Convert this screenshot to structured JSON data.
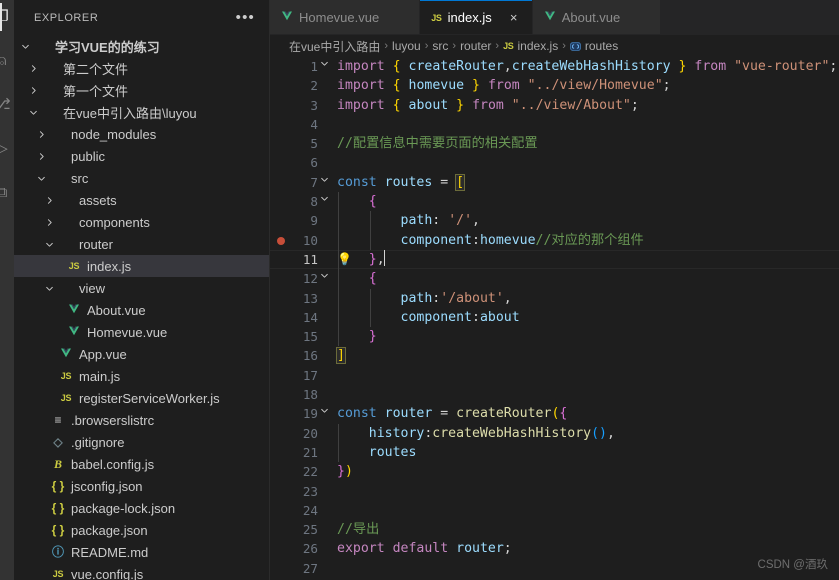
{
  "activity_bar": {
    "items": [
      {
        "name": "explorer",
        "glyph": "❐",
        "active": true
      },
      {
        "name": "search",
        "glyph": "⌕",
        "active": false
      },
      {
        "name": "source-control",
        "glyph": "⎇",
        "active": false
      },
      {
        "name": "run-and-debug",
        "glyph": "▷",
        "active": false
      },
      {
        "name": "extensions",
        "glyph": "⧉",
        "active": false
      }
    ]
  },
  "sidebar": {
    "header": {
      "title": "EXPLORER",
      "actions_label": "•••"
    },
    "tree": [
      {
        "label": "学习VUE的的练习",
        "indent": 0,
        "twisty": "down",
        "icon": "",
        "root": true,
        "selected": false
      },
      {
        "label": "第二个文件",
        "indent": 1,
        "twisty": "right",
        "icon": "",
        "root": false,
        "selected": false
      },
      {
        "label": "第一个文件",
        "indent": 1,
        "twisty": "right",
        "icon": "",
        "root": false,
        "selected": false
      },
      {
        "label": "在vue中引入路由\\luyou",
        "indent": 1,
        "twisty": "down",
        "icon": "",
        "root": false,
        "selected": false
      },
      {
        "label": "node_modules",
        "indent": 2,
        "twisty": "right",
        "icon": "",
        "root": false,
        "selected": false
      },
      {
        "label": "public",
        "indent": 2,
        "twisty": "right",
        "icon": "",
        "root": false,
        "selected": false
      },
      {
        "label": "src",
        "indent": 2,
        "twisty": "down",
        "icon": "",
        "root": false,
        "selected": false
      },
      {
        "label": "assets",
        "indent": 3,
        "twisty": "right",
        "icon": "",
        "root": false,
        "selected": false
      },
      {
        "label": "components",
        "indent": 3,
        "twisty": "right",
        "icon": "",
        "root": false,
        "selected": false
      },
      {
        "label": "router",
        "indent": 3,
        "twisty": "down",
        "icon": "",
        "root": false,
        "selected": false
      },
      {
        "label": "index.js",
        "indent": 4,
        "twisty": "",
        "icon": "js",
        "root": false,
        "selected": true
      },
      {
        "label": "view",
        "indent": 3,
        "twisty": "down",
        "icon": "",
        "root": false,
        "selected": false
      },
      {
        "label": "About.vue",
        "indent": 4,
        "twisty": "",
        "icon": "vue",
        "root": false,
        "selected": false
      },
      {
        "label": "Homevue.vue",
        "indent": 4,
        "twisty": "",
        "icon": "vue",
        "root": false,
        "selected": false
      },
      {
        "label": "App.vue",
        "indent": 3,
        "twisty": "",
        "icon": "vue",
        "root": false,
        "selected": false
      },
      {
        "label": "main.js",
        "indent": 3,
        "twisty": "",
        "icon": "js",
        "root": false,
        "selected": false
      },
      {
        "label": "registerServiceWorker.js",
        "indent": 3,
        "twisty": "",
        "icon": "js",
        "root": false,
        "selected": false
      },
      {
        "label": ".browserslistrc",
        "indent": 2,
        "twisty": "",
        "icon": "list",
        "root": false,
        "selected": false
      },
      {
        "label": ".gitignore",
        "indent": 2,
        "twisty": "",
        "icon": "git",
        "root": false,
        "selected": false
      },
      {
        "label": "babel.config.js",
        "indent": 2,
        "twisty": "",
        "icon": "babel",
        "root": false,
        "selected": false
      },
      {
        "label": "jsconfig.json",
        "indent": 2,
        "twisty": "",
        "icon": "json",
        "root": false,
        "selected": false
      },
      {
        "label": "package-lock.json",
        "indent": 2,
        "twisty": "",
        "icon": "json",
        "root": false,
        "selected": false
      },
      {
        "label": "package.json",
        "indent": 2,
        "twisty": "",
        "icon": "json",
        "root": false,
        "selected": false
      },
      {
        "label": "README.md",
        "indent": 2,
        "twisty": "",
        "icon": "md",
        "root": false,
        "selected": false
      },
      {
        "label": "vue.config.js",
        "indent": 2,
        "twisty": "",
        "icon": "js",
        "root": false,
        "selected": false
      }
    ]
  },
  "editor": {
    "tabs": [
      {
        "label": "Homevue.vue",
        "icon": "vue",
        "active": false,
        "close_label": "×"
      },
      {
        "label": "index.js",
        "icon": "js",
        "active": true,
        "close_label": "×"
      },
      {
        "label": "About.vue",
        "icon": "vue",
        "active": false,
        "close_label": "×"
      }
    ],
    "breadcrumb": [
      {
        "label": "在vue中引入路由",
        "icon": ""
      },
      {
        "label": "luyou",
        "icon": ""
      },
      {
        "label": "src",
        "icon": ""
      },
      {
        "label": "router",
        "icon": ""
      },
      {
        "label": "index.js",
        "icon": "js"
      },
      {
        "label": "routes",
        "icon": "symbol-variable"
      }
    ],
    "separator": "›",
    "active_line": 11,
    "breakpoint_line": 10,
    "lightbulb_line": 11,
    "lines": [
      {
        "n": 1,
        "fold": "down"
      },
      {
        "n": 2,
        "fold": ""
      },
      {
        "n": 3,
        "fold": ""
      },
      {
        "n": 4,
        "fold": ""
      },
      {
        "n": 5,
        "fold": ""
      },
      {
        "n": 6,
        "fold": ""
      },
      {
        "n": 7,
        "fold": "down"
      },
      {
        "n": 8,
        "fold": "down"
      },
      {
        "n": 9,
        "fold": ""
      },
      {
        "n": 10,
        "fold": ""
      },
      {
        "n": 11,
        "fold": ""
      },
      {
        "n": 12,
        "fold": "down"
      },
      {
        "n": 13,
        "fold": ""
      },
      {
        "n": 14,
        "fold": ""
      },
      {
        "n": 15,
        "fold": ""
      },
      {
        "n": 16,
        "fold": ""
      },
      {
        "n": 17,
        "fold": ""
      },
      {
        "n": 18,
        "fold": ""
      },
      {
        "n": 19,
        "fold": "down"
      },
      {
        "n": 20,
        "fold": ""
      },
      {
        "n": 21,
        "fold": ""
      },
      {
        "n": 22,
        "fold": ""
      },
      {
        "n": 23,
        "fold": ""
      },
      {
        "n": 24,
        "fold": ""
      },
      {
        "n": 25,
        "fold": ""
      },
      {
        "n": 26,
        "fold": ""
      },
      {
        "n": 27,
        "fold": ""
      }
    ],
    "source_text": [
      "import { createRouter,createWebHashHistory } from \"vue-router\";",
      "import { homevue } from \"../view/Homevue\";",
      "import { about } from \"../view/About\";",
      "",
      "//配置信息中需要页面的相关配置",
      "",
      "const routes = [",
      "    {",
      "        path: '/',",
      "        component:homevue//对应的那个组件",
      "    },",
      "    {",
      "        path:'/about',",
      "        component:about",
      "    }",
      "]",
      "",
      "",
      "const router = createRouter({",
      "    history:createWebHashHistory(),",
      "    routes",
      "})",
      "",
      "",
      "//导出",
      "export default router;",
      ""
    ]
  },
  "watermark": {
    "text": "CSDN @酒玖"
  },
  "colors": {
    "accent": "#0078d4",
    "editor_bg": "#1e1e1e",
    "sidebar_bg": "#1e1e1e",
    "tabbar_bg": "#252526",
    "selection_bg": "#37373d",
    "breakpoint": "#c74e39"
  }
}
